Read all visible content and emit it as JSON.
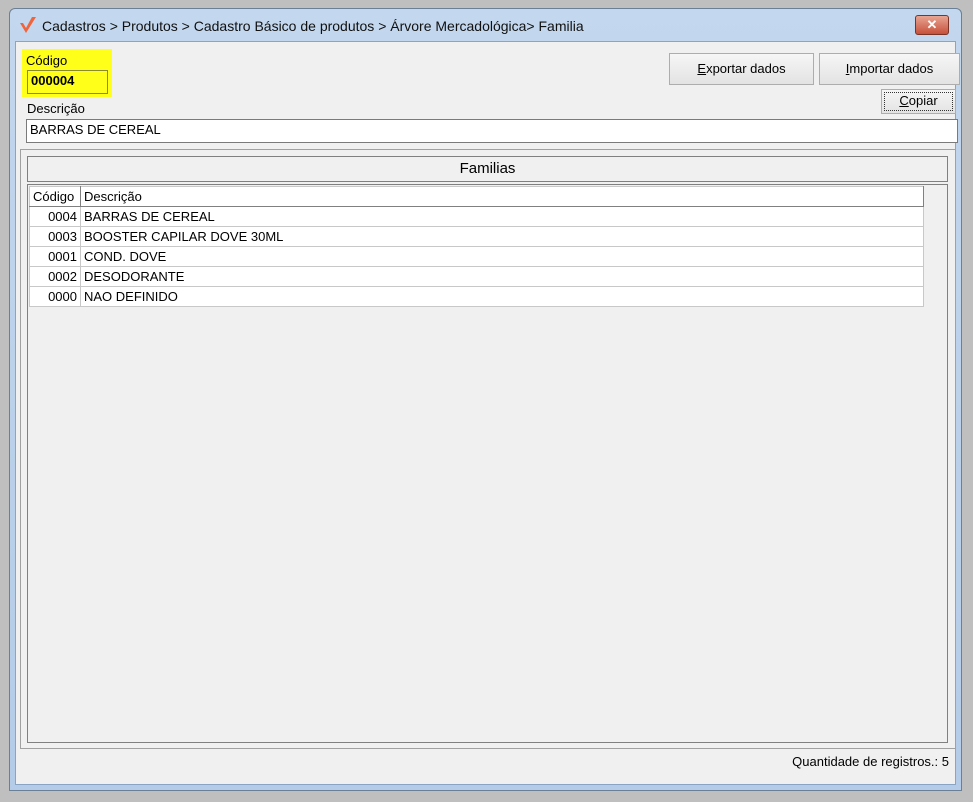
{
  "window": {
    "title": "Cadastros > Produtos > Cadastro Básico de produtos > Árvore Mercadológica> Familia",
    "close_label": "✕"
  },
  "form": {
    "codigo_label": "Código",
    "codigo_value": "000004",
    "descricao_label": "Descrição",
    "descricao_value": "BARRAS DE CEREAL"
  },
  "buttons": {
    "exportar_first": "E",
    "exportar_rest": "xportar dados",
    "importar_first": "I",
    "importar_rest": "mportar dados",
    "copiar_first": "C",
    "copiar_rest": "opiar"
  },
  "grid": {
    "title": "Familias",
    "columns": [
      "Código",
      "Descrição"
    ],
    "rows": [
      [
        "0004",
        "BARRAS DE CEREAL"
      ],
      [
        "0003",
        "BOOSTER CAPILAR DOVE 30ML"
      ],
      [
        "0001",
        "COND. DOVE"
      ],
      [
        "0002",
        "DESODORANTE"
      ],
      [
        "0000",
        "NAO DEFINIDO"
      ]
    ]
  },
  "footer": {
    "count_label": "Quantidade de registros.: 5"
  },
  "colors": {
    "highlight": "#ffff1a",
    "logo": "#f0643c"
  }
}
